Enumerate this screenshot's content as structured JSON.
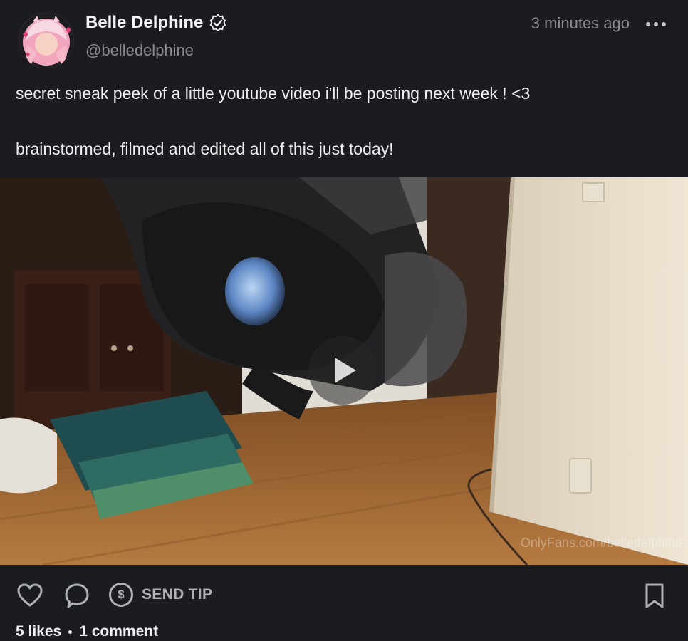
{
  "post": {
    "author_name": "Belle Delphine",
    "author_handle": "@belledelphine",
    "timestamp": "3 minutes ago",
    "text_line_1": "secret sneak peek of a little youtube video i'll be posting next week ! <3",
    "text_line_2": "brainstormed, filmed and edited all of this just today!",
    "watermark": "OnlyFans.com/belledelphine"
  },
  "actions": {
    "tip_icon_glyph": "$",
    "tip_label": "SEND TIP"
  },
  "stats": {
    "likes": "5 likes",
    "comments": "1 comment"
  },
  "icons": {
    "verified": "verified-badge-icon",
    "more": "more-options-icon",
    "like": "heart-icon",
    "comment": "comment-bubble-icon",
    "tip": "dollar-circle-icon",
    "bookmark": "bookmark-icon",
    "play": "play-icon"
  },
  "colors": {
    "background": "#1b1c1f",
    "text_primary": "#eceef0",
    "text_muted": "#8a8d93",
    "icon": "#aeb1b6"
  }
}
